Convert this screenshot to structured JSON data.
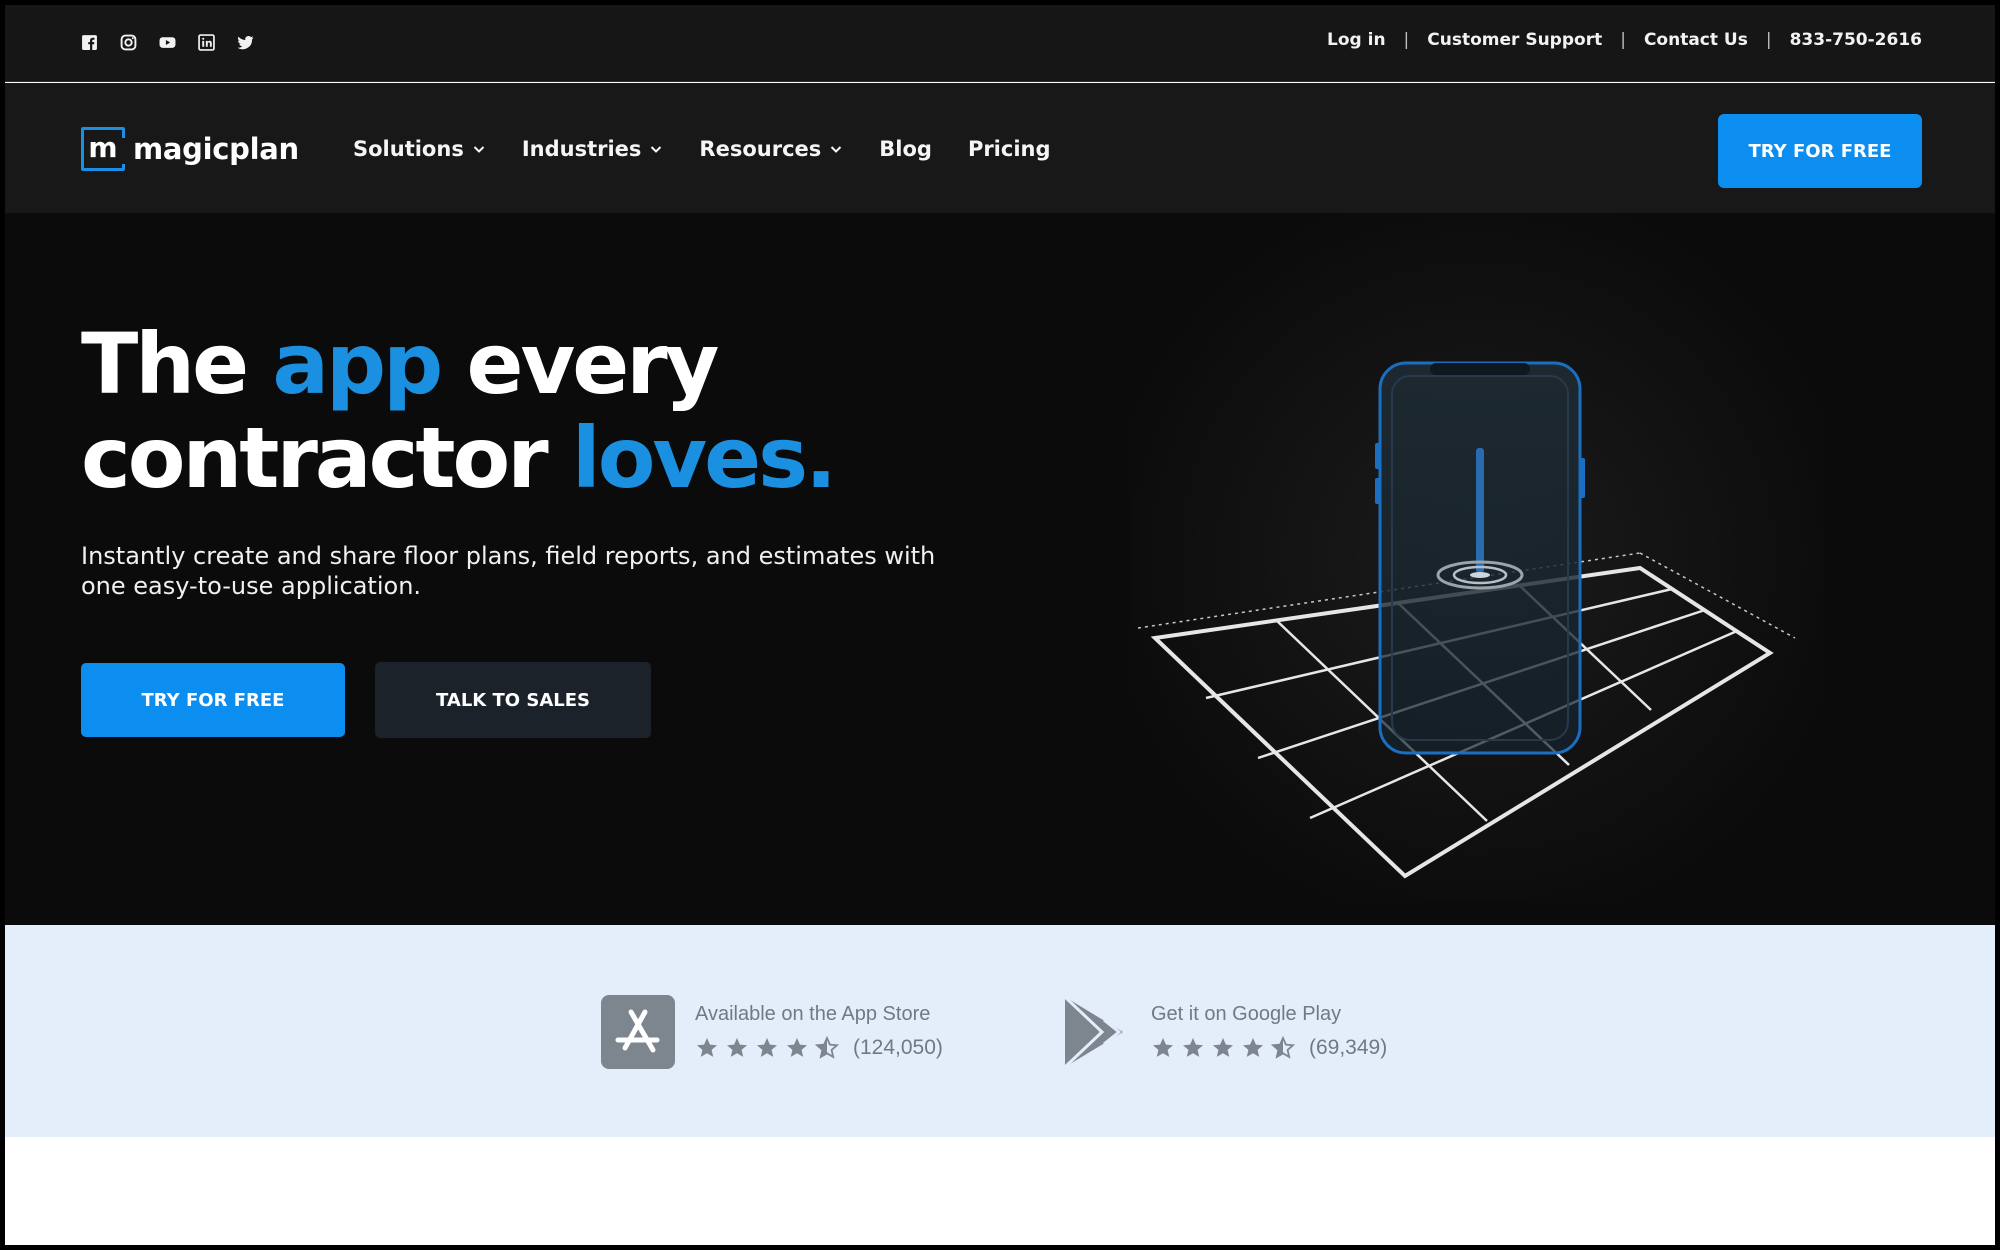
{
  "topbar": {
    "socials": [
      "facebook-icon",
      "instagram-icon",
      "youtube-icon",
      "linkedin-icon",
      "twitter-icon"
    ],
    "links": {
      "login": "Log in",
      "support": "Customer Support",
      "contact": "Contact Us",
      "phone": "833-750-2616"
    },
    "separator": "|"
  },
  "nav": {
    "logo_letter": "m",
    "logo_text": "magicplan",
    "items": [
      {
        "label": "Solutions",
        "dropdown": true
      },
      {
        "label": "Industries",
        "dropdown": true
      },
      {
        "label": "Resources",
        "dropdown": true
      },
      {
        "label": "Blog",
        "dropdown": false
      },
      {
        "label": "Pricing",
        "dropdown": false
      }
    ],
    "cta": "TRY FOR FREE"
  },
  "hero": {
    "headline": {
      "w1": "The",
      "w2": "app",
      "w3": "every",
      "w4": "contractor",
      "w5": "loves."
    },
    "subhead": "Instantly create and share floor plans, field reports, and estimates with one easy-to-use application.",
    "primary_button": "TRY FOR FREE",
    "secondary_button": "TALK TO SALES"
  },
  "stores": {
    "appstore": {
      "title": "Available on the App Store",
      "rating": 4.5,
      "count": "(124,050)"
    },
    "google": {
      "title": "Get it on Google Play",
      "rating": 4.5,
      "count": "(69,349)"
    }
  },
  "colors": {
    "accent": "#0b8ef0",
    "headline_blue": "#1b8fe0",
    "dark_bg": "#0b0b0b",
    "band_bg": "#e3eefa",
    "store_gray": "#6f7a85"
  }
}
